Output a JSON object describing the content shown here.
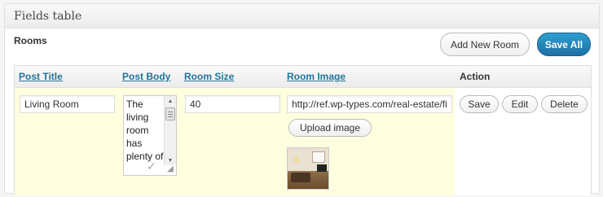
{
  "panel": {
    "title": "Fields table"
  },
  "section": {
    "label": "Rooms"
  },
  "toolbar": {
    "add_label": "Add New Room",
    "save_all_label": "Save All"
  },
  "table": {
    "columns": [
      "Post Title",
      "Post Body",
      "Room Size",
      "Room Image",
      "Action"
    ],
    "row": {
      "post_title": "Living Room",
      "post_body": "The living room has plenty of",
      "room_size": "40",
      "room_image_url": "http://ref.wp-types.com/real-estate/fi",
      "upload_label": "Upload image",
      "actions": {
        "save": "Save",
        "edit": "Edit",
        "delete": "Delete"
      }
    }
  },
  "icons": {
    "scroll_up": "triangle-up-icon",
    "scroll_down": "triangle-down-icon",
    "resize": "resize-grip-icon",
    "check": "check-icon"
  },
  "colors": {
    "link": "#21759b",
    "row_highlight": "#ffffe0",
    "primary_button": "#2e9fd2"
  }
}
